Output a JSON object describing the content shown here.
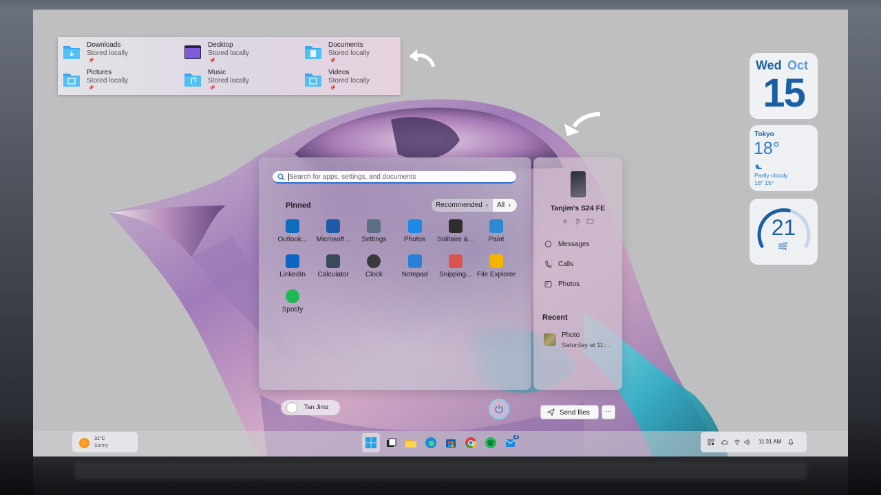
{
  "quick_access": [
    {
      "name": "Downloads",
      "status": "Stored locally",
      "icon": "downloads-folder-icon"
    },
    {
      "name": "Desktop",
      "status": "Stored locally",
      "icon": "desktop-folder-icon"
    },
    {
      "name": "Documents",
      "status": "Stored locally",
      "icon": "documents-folder-icon"
    },
    {
      "name": "Pictures",
      "status": "Stored locally",
      "icon": "pictures-folder-icon"
    },
    {
      "name": "Music",
      "status": "Stored locally",
      "icon": "music-folder-icon"
    },
    {
      "name": "Videos",
      "status": "Stored locally",
      "icon": "videos-folder-icon"
    }
  ],
  "start": {
    "search_placeholder": "Search for apps, settings, and documents",
    "pinned_label": "Pinned",
    "recommended_label": "Recommended",
    "all_label": "All",
    "pinned_apps": [
      {
        "label": "Outlook...",
        "icon": "outlook-icon",
        "color": "#0f6cbd"
      },
      {
        "label": "Microsoft...",
        "icon": "microsoft-store-icon",
        "color": "#1e5aa8"
      },
      {
        "label": "Settings",
        "icon": "settings-gear-icon",
        "color": "#5a6f86"
      },
      {
        "label": "Photos",
        "icon": "photos-icon",
        "color": "#1e88e5"
      },
      {
        "label": "Solitaire &...",
        "icon": "solitaire-icon",
        "color": "#2e2e2e"
      },
      {
        "label": "Paint",
        "icon": "paint-icon",
        "color": "#2f8ad1"
      },
      {
        "label": "LinkedIn",
        "icon": "linkedin-icon",
        "color": "#0a66c2"
      },
      {
        "label": "Calculator",
        "icon": "calculator-icon",
        "color": "#3b4a5a"
      },
      {
        "label": "Clock",
        "icon": "clock-icon",
        "color": "#3a3a3a"
      },
      {
        "label": "Notepad",
        "icon": "notepad-icon",
        "color": "#2b7fd6"
      },
      {
        "label": "Snipping...",
        "icon": "snipping-tool-icon",
        "color": "#d9534f"
      },
      {
        "label": "File Explorer",
        "icon": "file-explorer-icon",
        "color": "#f4b400"
      },
      {
        "label": "Spotify",
        "icon": "spotify-icon",
        "color": "#1db954"
      }
    ],
    "user_name": "Tan Jimz"
  },
  "phone": {
    "device_name": "Tanjim's S24 FE",
    "links": [
      {
        "label": "Messages",
        "icon": "messages-icon"
      },
      {
        "label": "Calls",
        "icon": "phone-call-icon"
      },
      {
        "label": "Photos",
        "icon": "photos-icon"
      }
    ],
    "recent_label": "Recent",
    "recent_item_title": "Photo",
    "recent_item_time": "Saturday at 11:...",
    "send_files_label": "Send files",
    "more_label": "···"
  },
  "widgets": {
    "date_day": "Wed",
    "date_month": "Oct",
    "date_number": "15",
    "weather_city": "Tokyo",
    "weather_temp": "18°",
    "weather_condition": "Partly cloudy",
    "weather_range": "18°  15°",
    "wind_value": "21",
    "wind_gauge_fraction": 0.55
  },
  "taskbar": {
    "weather_temp": "31°C",
    "weather_condition": "Sunny",
    "time": "11:31 AM",
    "mail_badge": "9"
  },
  "colors": {
    "accent": "#1b5fa3",
    "search_underline": "#2f6fcf"
  }
}
